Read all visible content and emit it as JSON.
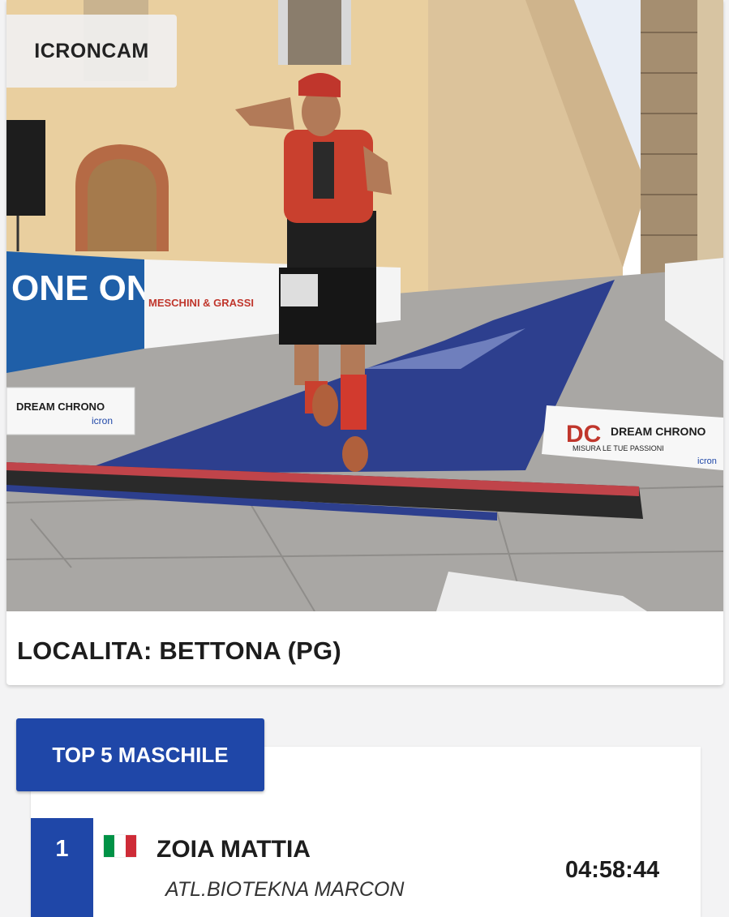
{
  "photo_card": {
    "badge": "ICRONCAM",
    "location": "LOCALITA: BETTONA (PG)",
    "banners": {
      "left_sponsor": "ONE ONE",
      "meschini": "MESCHINI & GRASSI",
      "dream_chrono_title": "DREAM CHRONO",
      "dream_chrono_tagline": "MISURA LE TUE PASSIONI",
      "icron": "icron",
      "dc_logo": "DC"
    }
  },
  "ranking": {
    "tab_label": "TOP 5 MASCHILE",
    "rows": [
      {
        "rank": "1",
        "name": "ZOIA MATTIA",
        "club": "ATL.BIOTEKNA MARCON",
        "time": "04:58:44",
        "flag_colors": [
          "#009246",
          "#ffffff",
          "#ce2b37"
        ]
      }
    ]
  },
  "colors": {
    "accent": "#1f47a8",
    "carpet": "#2d3f8e",
    "background": "#f3f3f4"
  }
}
